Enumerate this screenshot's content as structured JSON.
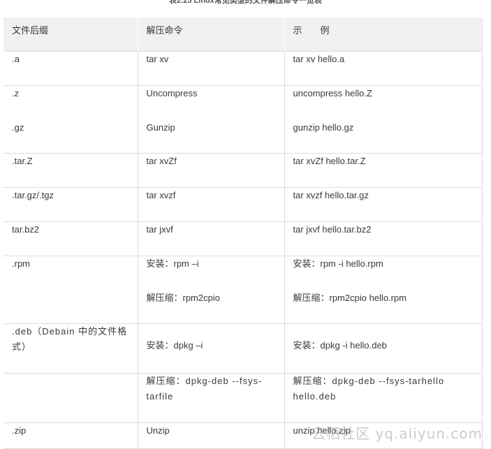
{
  "caption": "表2.25 Linux常见类型的文件解压命令一览表",
  "table": {
    "headers": [
      "文件后缀",
      "解压命令",
      "示　　例"
    ],
    "rows": [
      {
        "suffix": ".a",
        "command": "tar xv",
        "example": "tar xv hello.a"
      },
      {
        "suffix": ".z",
        "suffix2": ".gz",
        "command": "Uncompress",
        "command2": "Gunzip",
        "example": "uncompress hello.Z",
        "example2": "gunzip hello.gz"
      },
      {
        "suffix": ".tar.Z",
        "command": "tar xvZf",
        "example": "tar xvZf hello.tar.Z"
      },
      {
        "suffix": ".tar.gz/.tgz",
        "command": "tar xvzf",
        "example": "tar xvzf hello.tar.gz"
      },
      {
        "suffix": "tar.bz2",
        "command": "tar jxvf",
        "example": "tar jxvf hello.tar.bz2"
      },
      {
        "suffix": ".rpm",
        "command": "安装：rpm –i",
        "command2": "解压缩：rpm2cpio",
        "example": "安装：rpm -i hello.rpm",
        "example2": "解压缩：rpm2cpio hello.rpm"
      },
      {
        "suffix": ".deb（Debain 中的文件格式）",
        "command": "安装：dpkg –i",
        "example": "安装：dpkg -i hello.deb"
      },
      {
        "suffix": "",
        "command": "解压缩：dpkg-deb --fsys-tarfile",
        "example": "解压缩：dpkg-deb --fsys-tarhello hello.deb"
      },
      {
        "suffix": ".zip",
        "command": "Unzip",
        "example": "unzip hello.zip"
      }
    ]
  },
  "watermark": "云栖社区 yq.aliyun.com"
}
